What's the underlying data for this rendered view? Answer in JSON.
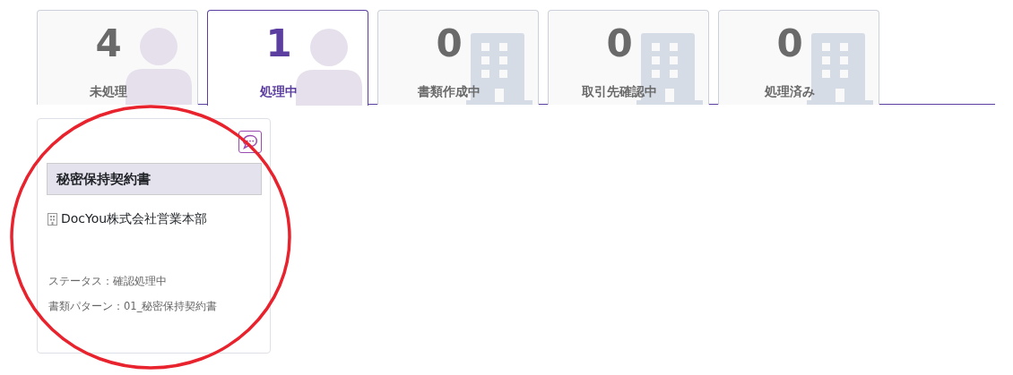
{
  "tabs": [
    {
      "count": "4",
      "label": "未処理",
      "kind": "person",
      "selected": false
    },
    {
      "count": "1",
      "label": "処理中",
      "kind": "person",
      "selected": true
    },
    {
      "count": "0",
      "label": "書類作成中",
      "kind": "building",
      "selected": false
    },
    {
      "count": "0",
      "label": "取引先確認中",
      "kind": "building",
      "selected": false
    },
    {
      "count": "0",
      "label": "処理済み",
      "kind": "building",
      "selected": false
    }
  ],
  "cards": [
    {
      "title": "秘密保持契約書",
      "company": "DocYou株式会社営業本部",
      "status": "ステータス：確認処理中",
      "pattern": "書類パターン：01_秘密保持契約書"
    }
  ],
  "annotation": {
    "color": "#e8232e"
  }
}
